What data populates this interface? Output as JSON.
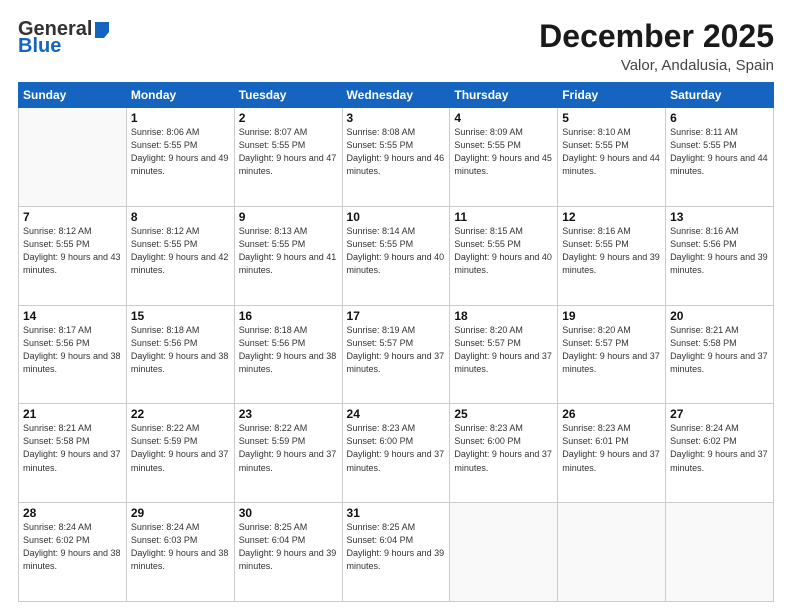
{
  "header": {
    "logo_general": "General",
    "logo_blue": "Blue",
    "month_title": "December 2025",
    "location": "Valor, Andalusia, Spain"
  },
  "weekdays": [
    "Sunday",
    "Monday",
    "Tuesday",
    "Wednesday",
    "Thursday",
    "Friday",
    "Saturday"
  ],
  "weeks": [
    [
      {
        "day": "",
        "info": ""
      },
      {
        "day": "1",
        "info": "Sunrise: 8:06 AM\nSunset: 5:55 PM\nDaylight: 9 hours\nand 49 minutes."
      },
      {
        "day": "2",
        "info": "Sunrise: 8:07 AM\nSunset: 5:55 PM\nDaylight: 9 hours\nand 47 minutes."
      },
      {
        "day": "3",
        "info": "Sunrise: 8:08 AM\nSunset: 5:55 PM\nDaylight: 9 hours\nand 46 minutes."
      },
      {
        "day": "4",
        "info": "Sunrise: 8:09 AM\nSunset: 5:55 PM\nDaylight: 9 hours\nand 45 minutes."
      },
      {
        "day": "5",
        "info": "Sunrise: 8:10 AM\nSunset: 5:55 PM\nDaylight: 9 hours\nand 44 minutes."
      },
      {
        "day": "6",
        "info": "Sunrise: 8:11 AM\nSunset: 5:55 PM\nDaylight: 9 hours\nand 44 minutes."
      }
    ],
    [
      {
        "day": "7",
        "info": "Sunrise: 8:12 AM\nSunset: 5:55 PM\nDaylight: 9 hours\nand 43 minutes."
      },
      {
        "day": "8",
        "info": "Sunrise: 8:12 AM\nSunset: 5:55 PM\nDaylight: 9 hours\nand 42 minutes."
      },
      {
        "day": "9",
        "info": "Sunrise: 8:13 AM\nSunset: 5:55 PM\nDaylight: 9 hours\nand 41 minutes."
      },
      {
        "day": "10",
        "info": "Sunrise: 8:14 AM\nSunset: 5:55 PM\nDaylight: 9 hours\nand 40 minutes."
      },
      {
        "day": "11",
        "info": "Sunrise: 8:15 AM\nSunset: 5:55 PM\nDaylight: 9 hours\nand 40 minutes."
      },
      {
        "day": "12",
        "info": "Sunrise: 8:16 AM\nSunset: 5:55 PM\nDaylight: 9 hours\nand 39 minutes."
      },
      {
        "day": "13",
        "info": "Sunrise: 8:16 AM\nSunset: 5:56 PM\nDaylight: 9 hours\nand 39 minutes."
      }
    ],
    [
      {
        "day": "14",
        "info": "Sunrise: 8:17 AM\nSunset: 5:56 PM\nDaylight: 9 hours\nand 38 minutes."
      },
      {
        "day": "15",
        "info": "Sunrise: 8:18 AM\nSunset: 5:56 PM\nDaylight: 9 hours\nand 38 minutes."
      },
      {
        "day": "16",
        "info": "Sunrise: 8:18 AM\nSunset: 5:56 PM\nDaylight: 9 hours\nand 38 minutes."
      },
      {
        "day": "17",
        "info": "Sunrise: 8:19 AM\nSunset: 5:57 PM\nDaylight: 9 hours\nand 37 minutes."
      },
      {
        "day": "18",
        "info": "Sunrise: 8:20 AM\nSunset: 5:57 PM\nDaylight: 9 hours\nand 37 minutes."
      },
      {
        "day": "19",
        "info": "Sunrise: 8:20 AM\nSunset: 5:57 PM\nDaylight: 9 hours\nand 37 minutes."
      },
      {
        "day": "20",
        "info": "Sunrise: 8:21 AM\nSunset: 5:58 PM\nDaylight: 9 hours\nand 37 minutes."
      }
    ],
    [
      {
        "day": "21",
        "info": "Sunrise: 8:21 AM\nSunset: 5:58 PM\nDaylight: 9 hours\nand 37 minutes."
      },
      {
        "day": "22",
        "info": "Sunrise: 8:22 AM\nSunset: 5:59 PM\nDaylight: 9 hours\nand 37 minutes."
      },
      {
        "day": "23",
        "info": "Sunrise: 8:22 AM\nSunset: 5:59 PM\nDaylight: 9 hours\nand 37 minutes."
      },
      {
        "day": "24",
        "info": "Sunrise: 8:23 AM\nSunset: 6:00 PM\nDaylight: 9 hours\nand 37 minutes."
      },
      {
        "day": "25",
        "info": "Sunrise: 8:23 AM\nSunset: 6:00 PM\nDaylight: 9 hours\nand 37 minutes."
      },
      {
        "day": "26",
        "info": "Sunrise: 8:23 AM\nSunset: 6:01 PM\nDaylight: 9 hours\nand 37 minutes."
      },
      {
        "day": "27",
        "info": "Sunrise: 8:24 AM\nSunset: 6:02 PM\nDaylight: 9 hours\nand 37 minutes."
      }
    ],
    [
      {
        "day": "28",
        "info": "Sunrise: 8:24 AM\nSunset: 6:02 PM\nDaylight: 9 hours\nand 38 minutes."
      },
      {
        "day": "29",
        "info": "Sunrise: 8:24 AM\nSunset: 6:03 PM\nDaylight: 9 hours\nand 38 minutes."
      },
      {
        "day": "30",
        "info": "Sunrise: 8:25 AM\nSunset: 6:04 PM\nDaylight: 9 hours\nand 39 minutes."
      },
      {
        "day": "31",
        "info": "Sunrise: 8:25 AM\nSunset: 6:04 PM\nDaylight: 9 hours\nand 39 minutes."
      },
      {
        "day": "",
        "info": ""
      },
      {
        "day": "",
        "info": ""
      },
      {
        "day": "",
        "info": ""
      }
    ]
  ]
}
